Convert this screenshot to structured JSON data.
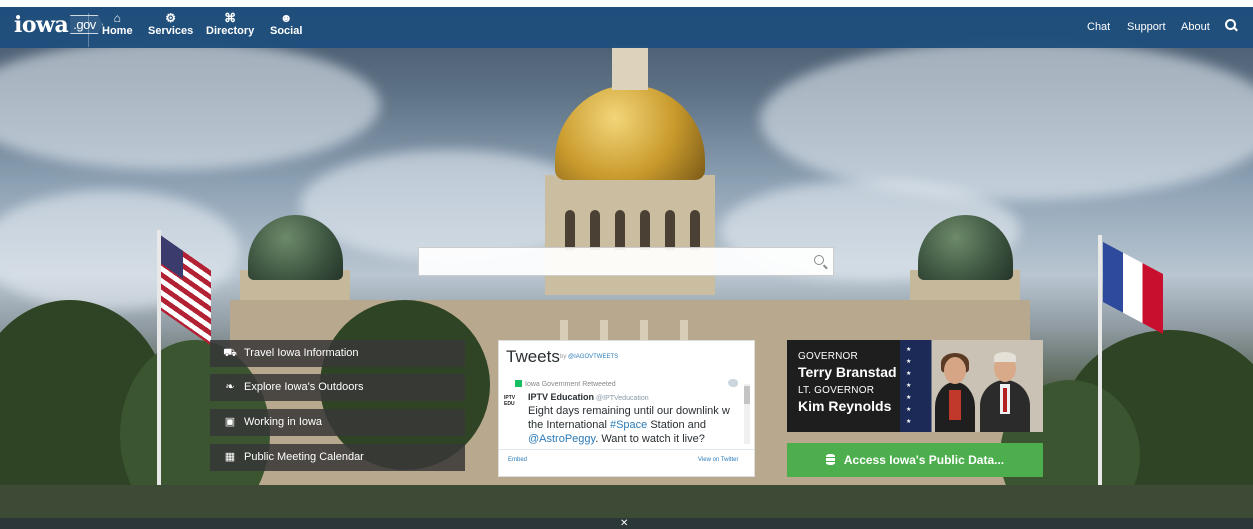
{
  "nav": {
    "logo_main": "iowa",
    "logo_suffix": ".gov",
    "items": [
      {
        "label": "Home",
        "icon": "home-icon",
        "glyph": "⌂"
      },
      {
        "label": "Services",
        "icon": "gears-icon",
        "glyph": "⚙"
      },
      {
        "label": "Directory",
        "icon": "building-icon",
        "glyph": "⌘"
      },
      {
        "label": "Social",
        "icon": "users-icon",
        "glyph": "☻"
      }
    ],
    "right_links": [
      "Chat",
      "Support",
      "About"
    ]
  },
  "search": {
    "placeholder": ""
  },
  "quick_links": [
    {
      "label": "Travel Iowa Information",
      "icon": "car-icon",
      "glyph": "⛟"
    },
    {
      "label": "Explore Iowa's Outdoors",
      "icon": "leaf-icon",
      "glyph": "❧"
    },
    {
      "label": "Working in Iowa",
      "icon": "briefcase-icon",
      "glyph": "▣"
    },
    {
      "label": "Public Meeting Calendar",
      "icon": "calendar-icon",
      "glyph": "▦"
    }
  ],
  "tweets": {
    "title": "Tweets",
    "by_prefix": "by",
    "by_handle": "@IAGOVTWEETS",
    "retweeted": "Iowa Government Retweeted",
    "avatar_text": "IPTV EDU",
    "author_name": "IPTV Education",
    "author_handle": "@IPTVeducation",
    "text_1": "Eight days remaining until our downlink w",
    "text_2a": "the International ",
    "text_2b": "#Space",
    "text_2c": " Station and",
    "text_3a": "@AstroPeggy",
    "text_3b": ". Want to watch it live?",
    "embed": "Embed",
    "view": "View on Twitter"
  },
  "governor": {
    "role1": "GOVERNOR",
    "name1": "Terry Branstad",
    "role2": "LT. GOVERNOR",
    "name2": "Kim Reynolds"
  },
  "data_button": {
    "label": "Access Iowa's Public Data..."
  },
  "colors": {
    "navbar": "#1f4e7d",
    "data_button": "#4cae4c",
    "link": "#2b7bb9"
  }
}
